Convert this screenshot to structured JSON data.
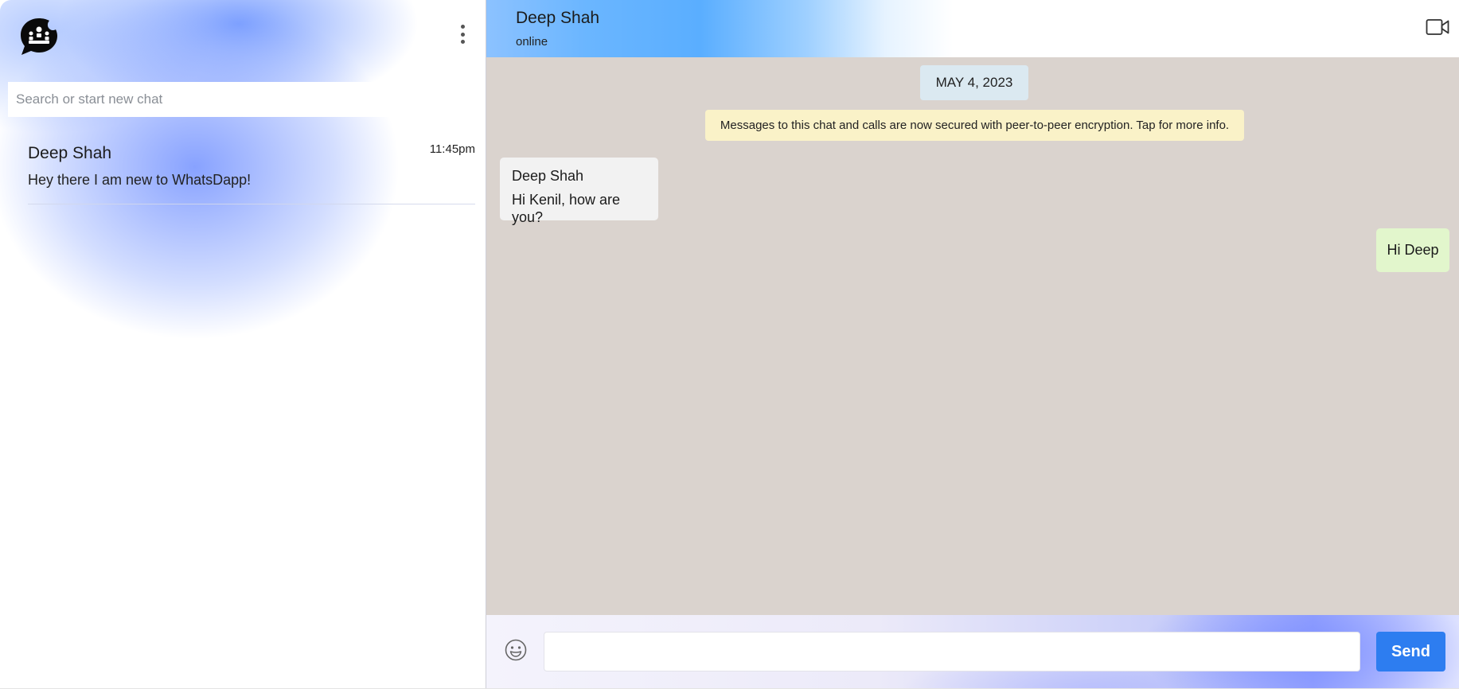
{
  "app": {
    "logo_icon": "chat-bubble-group-icon",
    "menu_icon": "kebab-menu-icon",
    "accent_color": "#2d7df0"
  },
  "sidebar": {
    "search": {
      "placeholder": "Search or start new chat",
      "value": ""
    },
    "chats": [
      {
        "name": "Deep Shah",
        "time": "11:45pm",
        "preview": "Hey there I am new to WhatsDapp!"
      }
    ]
  },
  "chat": {
    "header": {
      "name": "Deep Shah",
      "status": "online",
      "video_icon": "video-call-icon"
    },
    "date_label": "MAY 4, 2023",
    "encryption_notice": "Messages to this chat and calls are now secured with peer-to-peer encryption. Tap for more info.",
    "messages": [
      {
        "direction": "incoming",
        "sender": "Deep Shah",
        "text": "Hi Kenil, how are you?"
      },
      {
        "direction": "outgoing",
        "text": "Hi Deep"
      }
    ],
    "composer": {
      "emoji_icon": "smiley-icon",
      "input_value": "",
      "input_placeholder": "",
      "send_label": "Send"
    },
    "colors": {
      "chat_background": "#dad3ce",
      "incoming_bubble": "#f2f2f2",
      "outgoing_bubble": "#e2f6cc",
      "date_pill": "#dbe9f1",
      "encryption_banner": "#faf2c8"
    }
  }
}
